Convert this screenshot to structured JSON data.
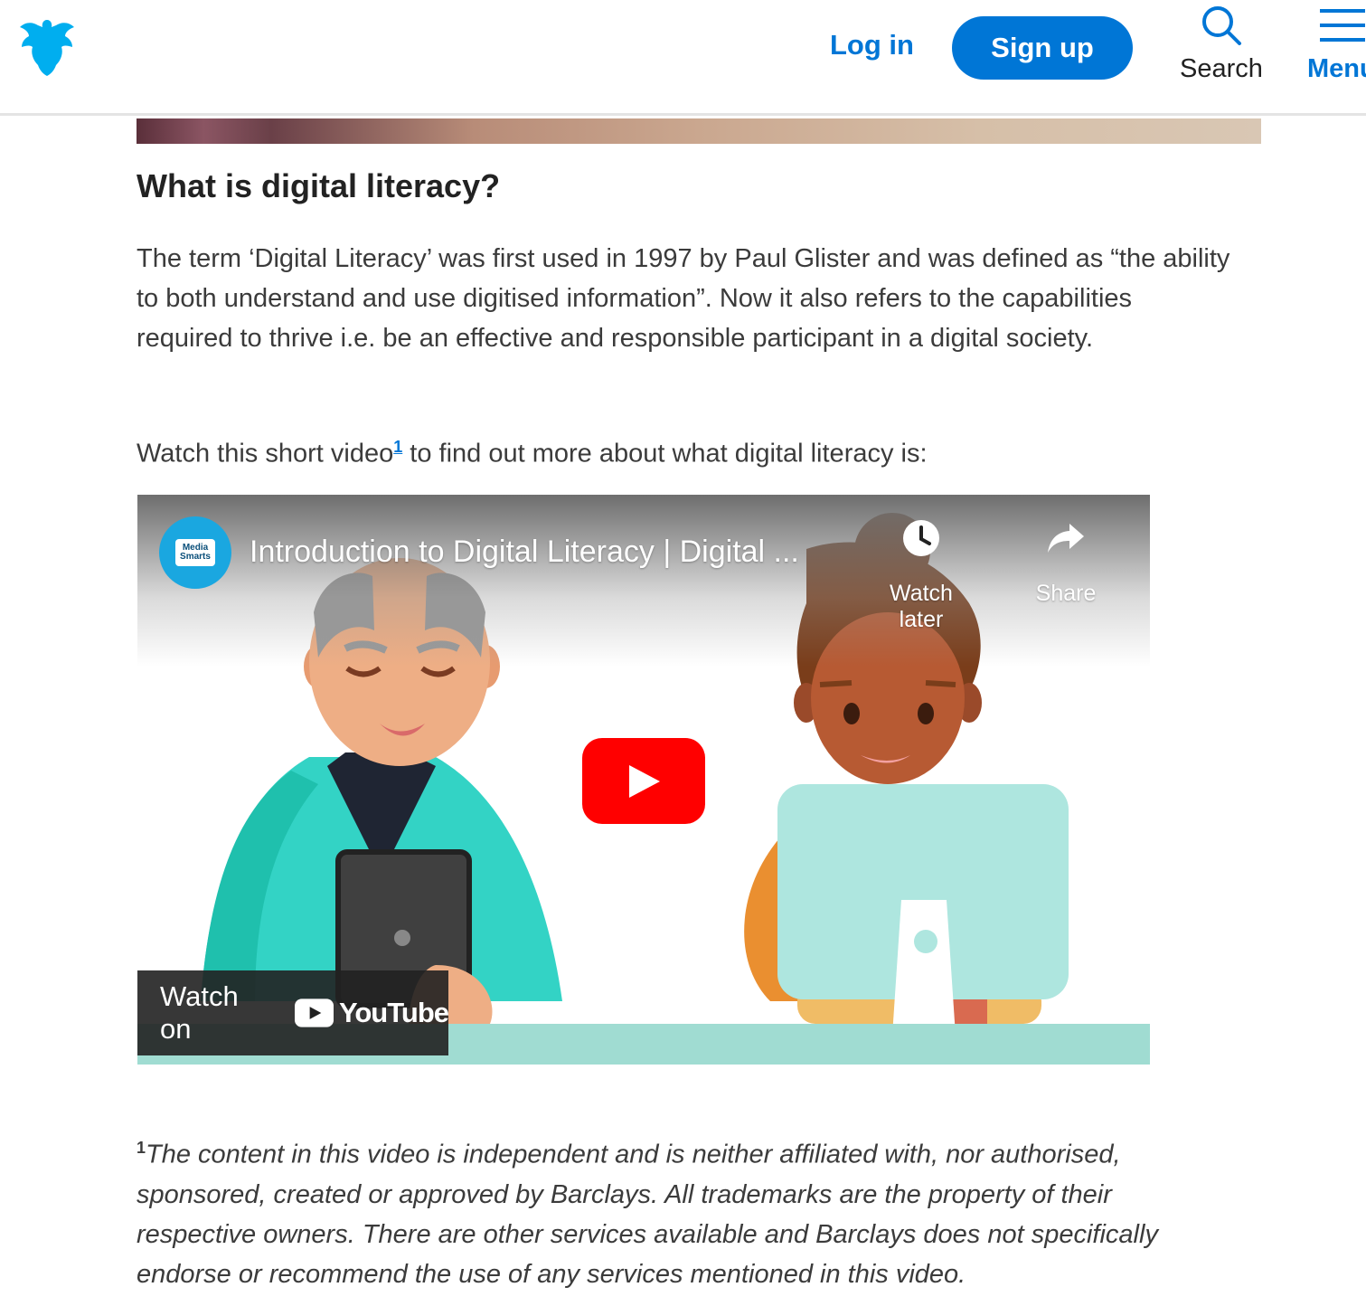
{
  "header": {
    "login_label": "Log in",
    "signup_label": "Sign up",
    "search_label": "Search",
    "menu_label": "Menu",
    "brand_color": "#0076d6"
  },
  "article": {
    "heading": "What is digital literacy?",
    "paragraph": "The term ‘Digital Literacy’ was first used in 1997 by Paul Glister and was defined as “the ability to both understand and use digitised information”. Now it also refers to the capabilities required to thrive i.e. be an effective and responsible participant in a digital society.",
    "watch_prefix": "Watch this short video",
    "footnote_marker": "1",
    "watch_suffix": " to find out more about what digital literacy is:"
  },
  "video": {
    "channel_avatar_text": "Media Smarts",
    "title": "Introduction to Digital Literacy | Digital ...",
    "watch_later_label": "Watch later",
    "share_label": "Share",
    "watch_on_label": "Watch on",
    "youtube_label": "YouTube",
    "play_icon": "play-icon"
  },
  "footnote": {
    "marker": "1",
    "text": "The content in this video is independent and is neither affiliated with, nor authorised, sponsored, created or approved by Barclays. All trademarks are the property of their respective owners. There are other services available and Barclays does not specifically endorse or recommend the use of any services mentioned in this video."
  }
}
